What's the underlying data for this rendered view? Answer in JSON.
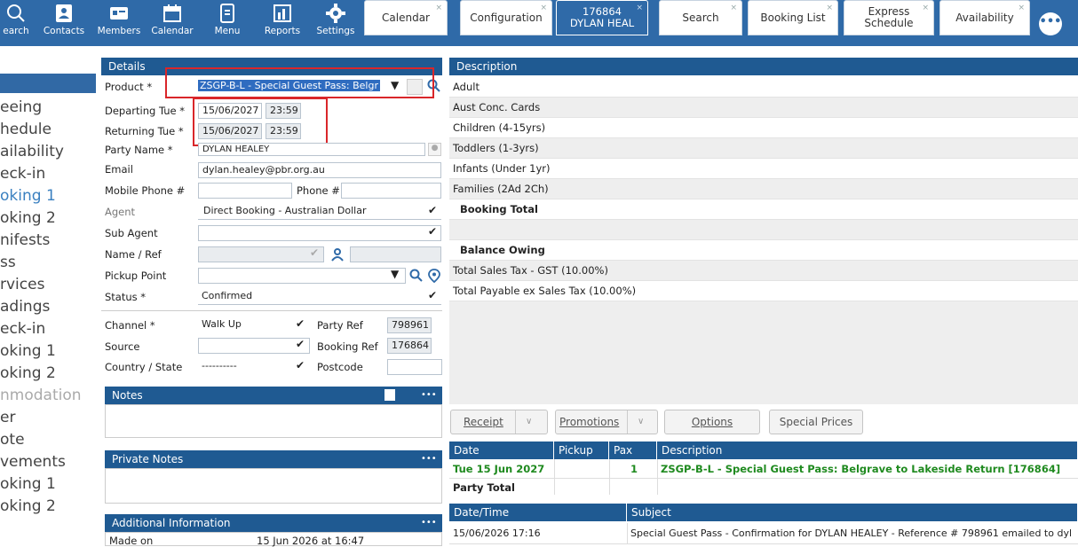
{
  "toolbar": {
    "search": "earch",
    "contacts": "Contacts",
    "members": "Members",
    "calendar": "Calendar",
    "menu": "Menu",
    "reports": "Reports",
    "settings": "Settings"
  },
  "tabs": [
    {
      "label": "Calendar"
    },
    {
      "label": "Configuration"
    },
    {
      "label": "176864 DYLAN HEAL"
    },
    {
      "label": "Search"
    },
    {
      "label": "Booking List"
    },
    {
      "label": "Express Schedule"
    },
    {
      "label": "Availability"
    }
  ],
  "sidebar": {
    "items": [
      "eeing",
      "hedule",
      "ailability",
      "eck-in",
      "oking 1",
      "oking 2",
      "nifests",
      "ss",
      "rvices",
      "adings",
      "eck-in",
      "oking 1",
      "oking 2",
      "nmodation",
      "er",
      "ote",
      "vements",
      "oking 1",
      "oking 2"
    ]
  },
  "details": {
    "title": "Details",
    "product_label": "Product *",
    "product_value": "ZSGP-B-L - Special Guest Pass: Belgr",
    "departing_label": "Departing Tue *",
    "departing_date": "15/06/2027",
    "departing_time": "23:59",
    "returning_label": "Returning Tue *",
    "returning_date": "15/06/2027",
    "returning_time": "23:59",
    "party_label": "Party Name *",
    "party_value": "DYLAN HEALEY",
    "email_label": "Email",
    "email_value": "dylan.healey@pbr.org.au",
    "mobile_label": "Mobile Phone #",
    "phone_label": "Phone #",
    "agent_label": "Agent",
    "agent_value": "Direct Booking - Australian Dollar",
    "subagent_label": "Sub Agent",
    "nameref_label": "Name / Ref",
    "pickup_label": "Pickup Point",
    "status_label": "Status *",
    "status_value": "Confirmed",
    "channel_label": "Channel *",
    "channel_value": "Walk Up",
    "partyref_label": "Party Ref",
    "partyref_value": "798961",
    "source_label": "Source",
    "bookingref_label": "Booking Ref",
    "bookingref_value": "176864",
    "country_label": "Country / State",
    "country_value": "----------",
    "postcode_label": "Postcode"
  },
  "notes": {
    "title": "Notes",
    "dots": "•••"
  },
  "private_notes": {
    "title": "Private Notes",
    "dots": "•••"
  },
  "additional": {
    "title": "Additional Information",
    "dots": "•••",
    "made_on_label": "Made on",
    "made_on_value": "15 Jun 2026 at 16:47"
  },
  "description": {
    "title": "Description",
    "rows": [
      "Adult",
      "Aust Conc. Cards",
      "Children (4-15yrs)",
      "Toddlers (1-3yrs)",
      "Infants (Under 1yr)",
      "Families (2Ad 2Ch)"
    ],
    "booking_total": "Booking Total",
    "balance_owing": "Balance Owing",
    "gst": "Total Sales Tax - GST (10.00%)",
    "payable": "Total Payable ex Sales Tax (10.00%)"
  },
  "buttons": {
    "receipt": "Receipt",
    "promotions": "Promotions",
    "options": "Options",
    "special_prices": "Special Prices"
  },
  "items_table": {
    "headers": [
      "Date",
      "Pickup",
      "Pax",
      "Description"
    ],
    "row": {
      "date": "Tue 15 Jun 2027",
      "pax": "1",
      "description": "ZSGP-B-L - Special Guest Pass: Belgrave to Lakeside Return [176864]"
    },
    "party_total": "Party Total"
  },
  "comms_table": {
    "headers": [
      "Date/Time",
      "Subject"
    ],
    "row": {
      "datetime": "15/06/2026 17:16",
      "subject": "Special Guest Pass - Confirmation for DYLAN HEALEY - Reference # 798961 emailed to dyl"
    }
  }
}
